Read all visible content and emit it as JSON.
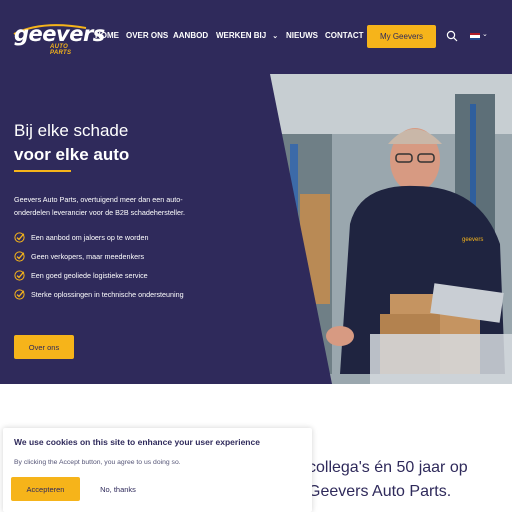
{
  "header": {
    "logo_text": "geevers",
    "logo_sub": "AUTO PARTS",
    "nav": [
      {
        "label": "HOME",
        "active": true
      },
      {
        "label": "OVER ONS"
      },
      {
        "label": "AANBOD"
      },
      {
        "label": "WERKEN BIJ",
        "has_dropdown": true
      },
      {
        "label": "NIEUWS"
      },
      {
        "label": "CONTACT"
      }
    ],
    "cta_label": "My Geevers",
    "search_icon": "search-icon",
    "language_flag": "flag-nl-icon"
  },
  "hero": {
    "title_line1": "Bij elke schade",
    "title_line2": "voor elke auto",
    "intro": "Geevers Auto Parts, overtuigend meer dan een auto-onderdelen leverancier voor de B2B schadehersteller.",
    "bullets": [
      "Een aanbod om jaloers op te worden",
      "Geen verkopers, maar meedenkers",
      "Een goed geoliede logistieke service",
      "Sterke oplossingen in technische ondersteuning"
    ],
    "button_label": "Over ons"
  },
  "lower": {
    "line1": "collega's én 50 jaar op",
    "line2": "Geevers Auto Parts."
  },
  "cookie": {
    "title": "We use cookies on this site to enhance your user experience",
    "description": "By clicking the Accept button, you agree to us doing so.",
    "accept_label": "Accepteren",
    "decline_label": "No, thanks"
  },
  "colors": {
    "navy": "#2f2a5b",
    "accent": "#f6b41a",
    "white": "#ffffff"
  }
}
